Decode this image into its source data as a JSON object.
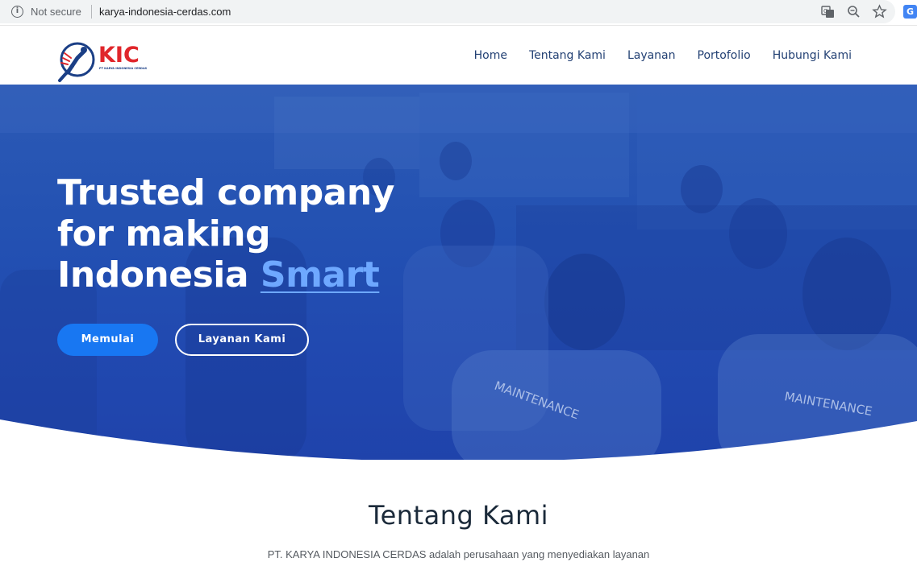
{
  "browser": {
    "security_label": "Not secure",
    "url": "karya-indonesia-cerdas.com",
    "icons": [
      "info-icon",
      "translate-icon",
      "zoom-icon",
      "star-icon",
      "extension-icon"
    ]
  },
  "nav": {
    "logo_text": "KIC",
    "logo_subtext": "PT KARYA INDONESIA CERDAS",
    "links": [
      "Home",
      "Tentang Kami",
      "Layanan",
      "Portofolio",
      "Hubungi Kami"
    ]
  },
  "hero": {
    "heading_line1": "Trusted company",
    "heading_line2": "for making",
    "heading_line3_prefix": "Indonesia ",
    "heading_accent": "Smart",
    "primary_button": "Memulai",
    "secondary_button": "Layanan Kami",
    "bg_words": [
      "MAINTENANCE",
      "MAINTENANCE"
    ]
  },
  "about": {
    "title": "Tentang Kami",
    "text": "PT. KARYA INDONESIA CERDAS adalah perusahaan yang menyediakan layanan"
  },
  "colors": {
    "hero_blue": "#2351b2",
    "primary_button": "#1877f2",
    "accent": "#6ea8ff",
    "logo_red": "#e0262b",
    "nav_text": "#234174"
  }
}
